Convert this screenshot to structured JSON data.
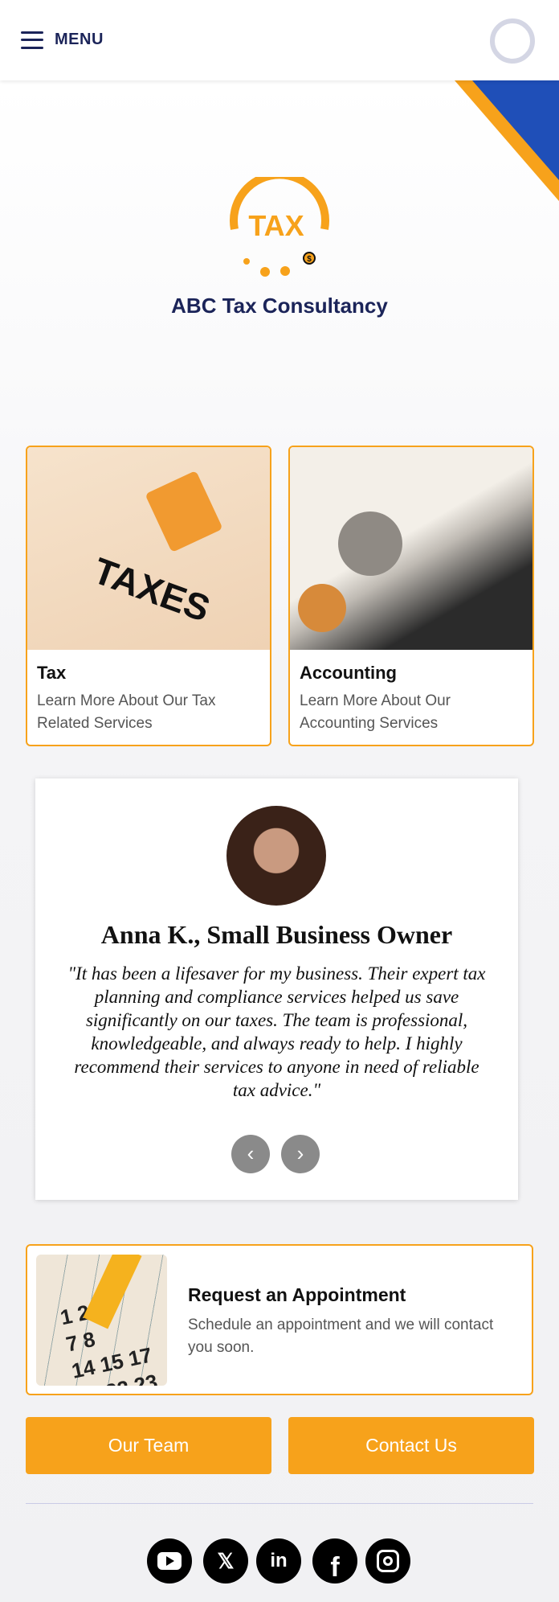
{
  "header": {
    "menu_label": "MENU",
    "menu_icon": "hamburger-icon"
  },
  "brand": {
    "logo_text": "TAX",
    "title": "ABC Tax Consultancy",
    "accent": "#f7a21b",
    "navy": "#1b2459"
  },
  "cards": [
    {
      "title": "Tax",
      "desc": "Learn More About Our Tax Related Services"
    },
    {
      "title": "Accounting",
      "desc": "Learn More About Our Accounting Services"
    }
  ],
  "testimonial": {
    "name": "Anna K., Small Business Owner",
    "quote": "\"It has been a lifesaver for my business. Their expert tax planning and compliance services helped us save significantly on our taxes. The team is professional, knowledgeable, and always ready to help. I highly recommend their services to anyone in need of reliable tax advice.\"",
    "prev_icon": "chevron-left-icon",
    "next_icon": "chevron-right-icon"
  },
  "appointment": {
    "title": "Request an Appointment",
    "desc": "Schedule an appointment and we will contact you soon."
  },
  "buttons": {
    "team": "Our Team",
    "contact": "Contact Us"
  },
  "social": [
    "youtube",
    "x",
    "linkedin",
    "facebook",
    "instagram"
  ]
}
